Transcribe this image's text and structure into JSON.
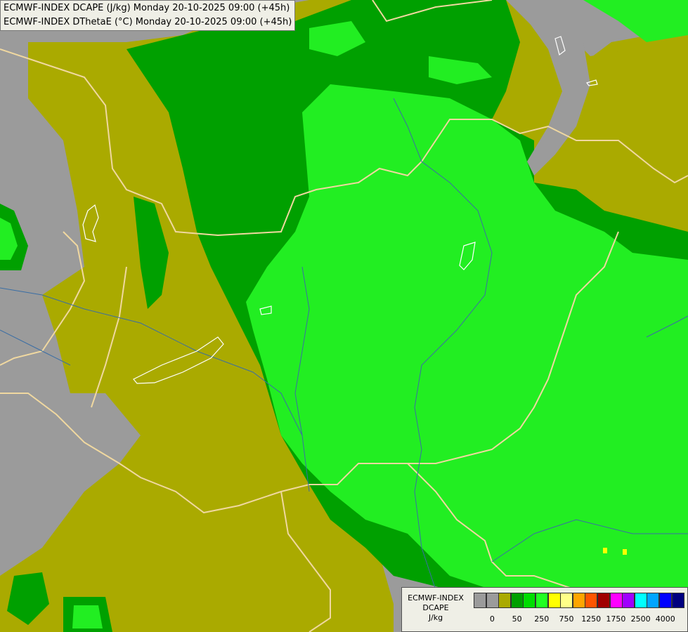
{
  "titles": {
    "line1": "ECMWF-INDEX DCAPE (J/kg) Monday 20-10-2025 09:00 (+45h)",
    "line2": "ECMWF-INDEX DThetaE (°C) Monday 20-10-2025 09:00 (+45h)"
  },
  "legend": {
    "title_line1": "ECMWF-INDEX",
    "title_line2": "DCAPE",
    "unit": "J/kg",
    "colors": [
      "#9b9b9b",
      "#9b9b9b",
      "#aaaa00",
      "#00a000",
      "#00dd00",
      "#22ff22",
      "#ffff00",
      "#ffff88",
      "#ffa500",
      "#ff5500",
      "#a00000",
      "#ff00ff",
      "#a000ff",
      "#00ffff",
      "#00a5ff",
      "#0000ff",
      "#00007f"
    ],
    "ticks": [
      "0",
      "50",
      "250",
      "750",
      "1250",
      "1750",
      "2500",
      "4000"
    ]
  },
  "map_colors": {
    "no_data": "#9b9b9b",
    "level_0": "#aaaa00",
    "level_50": "#00a000",
    "level_250": "#00dd00",
    "border": "#f0d8a0",
    "lake": "#ffffff",
    "river": "#3a6ea5"
  }
}
